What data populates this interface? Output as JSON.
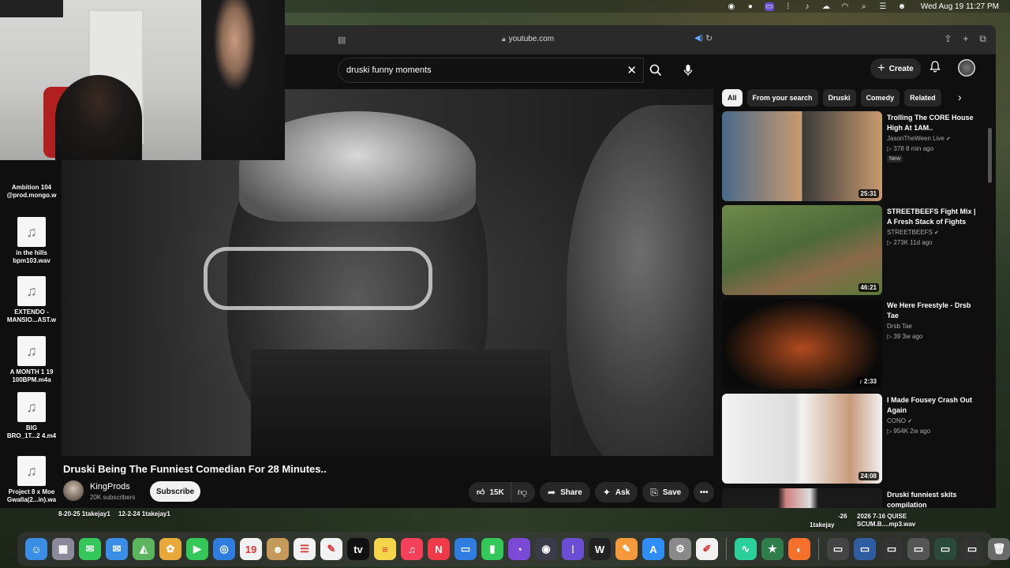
{
  "menubar": {
    "clock": "Wed Aug 19  11:27 PM",
    "icons": [
      "creative-cloud-icon",
      "screen-record-icon",
      "control-center-icon",
      "music-icon",
      "wifi-icon",
      "search-icon",
      "user-icon",
      "menu-extra-icon"
    ]
  },
  "browser": {
    "url": "youtube.com"
  },
  "youtube": {
    "search_value": "druski funny moments",
    "create_label": "Create",
    "video_title": "Druski Being The Funniest Comedian For 28 Minutes..",
    "channel_name": "KingProds",
    "channel_subs": "20K subscribers",
    "subscribe_label": "Subscribe",
    "likes": "15K",
    "share_label": "Share",
    "ask_label": "Ask",
    "save_label": "Save",
    "chips": [
      "All",
      "From your search",
      "Druski",
      "Comedy",
      "Related"
    ],
    "recommendations": [
      {
        "title": "Trolling The CORE House High At 1AM..",
        "channel": "JasonTheWeen Live",
        "meta": "378  8 min ago",
        "badge": "New",
        "duration": "25:31",
        "thumb_colors": [
          "#4a6a8a",
          "#c89a70"
        ]
      },
      {
        "title": "STREETBEEFS Fight Mix | A Fresh Stack of Fights",
        "channel": "STREETBEEFS",
        "meta": "273K  11d ago",
        "badge": "",
        "duration": "46:21",
        "thumb_colors": [
          "#4d6a3a",
          "#c8a070"
        ]
      },
      {
        "title": "We Here Freestyle - Drsb Tae",
        "channel": "Drsb Tae",
        "meta": "39  3w ago",
        "badge": "",
        "duration": "2:33",
        "thumb_colors": [
          "#0a0a0a",
          "#b04a20"
        ]
      },
      {
        "title": "I Made Fousey Crash Out Again",
        "channel": "CONO",
        "meta": "954K  2w ago",
        "badge": "",
        "duration": "24:08",
        "thumb_colors": [
          "#f2f2f2",
          "#c89a7a"
        ]
      },
      {
        "title": "Druski funniest skits compilation",
        "channel": "",
        "meta": "",
        "badge": "",
        "duration": "",
        "thumb_colors": [
          "#1a1a1a",
          "#d08080"
        ]
      }
    ]
  },
  "desktop": {
    "files": [
      {
        "name": "Ambition 104\n@prod.mongo.w"
      },
      {
        "name": "in the hills\nbpm103.wav"
      },
      {
        "name": "EXTENDO -\nMANSIO...AST.w"
      },
      {
        "name": "A MONTH 1 19\n100BPM.m4a"
      },
      {
        "name": "BIG\nBRO_1T...2 4.m4"
      },
      {
        "name": "Project 8 x Moe\nGwalla(2...in).wa"
      }
    ],
    "bottom_labels": {
      "left": "8-20-25 1takejay1",
      "left2": "12-2-24 1takejay1",
      "mid": "-26",
      "right_1": "2026 7-16 QUISE",
      "right_2": "SCUM.B....mp3.wav",
      "right_3": "1takejay"
    }
  },
  "dock": {
    "apps": [
      {
        "name": "finder-icon",
        "glyph": "☺",
        "color": "#3a8ee6"
      },
      {
        "name": "launchpad-icon",
        "glyph": "▦",
        "color": "#8a8a9a"
      },
      {
        "name": "messages-icon",
        "glyph": "✉",
        "color": "#34c759"
      },
      {
        "name": "mail-icon",
        "glyph": "✉",
        "color": "#3a8ee6"
      },
      {
        "name": "maps-icon",
        "glyph": "◭",
        "color": "#5ab55e"
      },
      {
        "name": "photos-icon",
        "glyph": "✿",
        "color": "#e8a83a"
      },
      {
        "name": "facetime-icon",
        "glyph": "▶",
        "color": "#34c759"
      },
      {
        "name": "safari-icon",
        "glyph": "◎",
        "color": "#2f7de1"
      },
      {
        "name": "calendar-icon",
        "glyph": "19",
        "color": "#f2f2f2"
      },
      {
        "name": "contacts-icon",
        "glyph": "☻",
        "color": "#c69a5a"
      },
      {
        "name": "reminders-icon",
        "glyph": "☰",
        "color": "#f2f2f2"
      },
      {
        "name": "freeform-icon",
        "glyph": "✎",
        "color": "#f2f2f2"
      },
      {
        "name": "apple-tv-icon",
        "glyph": "tv",
        "color": "#111111"
      },
      {
        "name": "notes-icon",
        "glyph": "≡",
        "color": "#f5d54a"
      },
      {
        "name": "music-icon",
        "glyph": "♫",
        "color": "#f5405a"
      },
      {
        "name": "news-icon",
        "glyph": "N",
        "color": "#f03a4a"
      },
      {
        "name": "keynote-icon",
        "glyph": "▭",
        "color": "#2f7de1"
      },
      {
        "name": "numbers-icon",
        "glyph": "▮",
        "color": "#34c759"
      },
      {
        "name": "logic-icon",
        "glyph": "◔",
        "color": "#7a4ad6"
      },
      {
        "name": "screen-share-icon",
        "glyph": "◉",
        "color": "#3a3a4a"
      },
      {
        "name": "app-grid-icon",
        "glyph": "⁞",
        "color": "#6a4fd6"
      },
      {
        "name": "waves-icon",
        "glyph": "W",
        "color": "#222222"
      },
      {
        "name": "pages-icon",
        "glyph": "✎",
        "color": "#f59a3a"
      },
      {
        "name": "app-store-icon",
        "glyph": "A",
        "color": "#2f8ef6"
      },
      {
        "name": "system-settings-icon",
        "glyph": "⚙",
        "color": "#8a8a8a"
      },
      {
        "name": "textedit-icon",
        "glyph": "✐",
        "color": "#f2f2f2"
      },
      {
        "name": "activity-icon",
        "glyph": "∿",
        "color": "#2bcf9a"
      },
      {
        "name": "star-app-icon",
        "glyph": "★",
        "color": "#2f7d4a"
      },
      {
        "name": "firefox-icon",
        "glyph": "◐",
        "color": "#f5702a"
      },
      {
        "name": "window-1-icon",
        "glyph": "▭",
        "color": "#444444"
      },
      {
        "name": "window-2-icon",
        "glyph": "▭",
        "color": "#2f5da1"
      },
      {
        "name": "window-3-icon",
        "glyph": "▭",
        "color": "#333333"
      },
      {
        "name": "window-4-icon",
        "glyph": "▭",
        "color": "#555555"
      },
      {
        "name": "window-5-icon",
        "glyph": "▭",
        "color": "#2a4a3a"
      },
      {
        "name": "window-6-icon",
        "glyph": "▭",
        "color": "#333333"
      },
      {
        "name": "trash-icon",
        "glyph": "🗑",
        "color": "#6a6a6a"
      }
    ]
  }
}
